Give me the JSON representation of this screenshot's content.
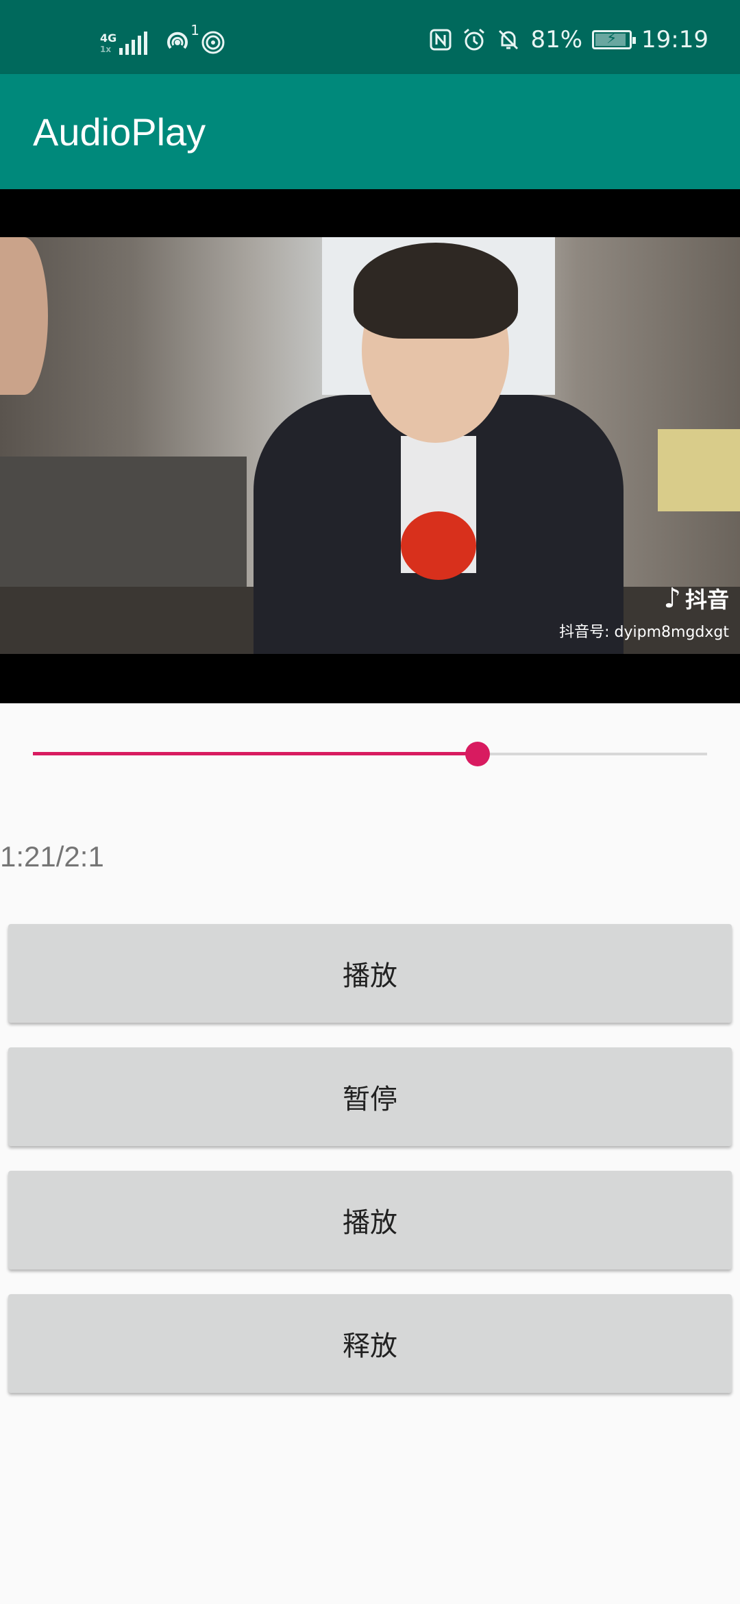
{
  "status_bar": {
    "network_type": "4G",
    "network_sub": "1x",
    "hotspot_superscript": "1",
    "battery": "81%",
    "battery_level": 0.81,
    "time": "19:19",
    "icons": [
      "signal-icon",
      "hotspot-icon",
      "wifi-icon",
      "nfc-icon",
      "alarm-icon",
      "mute-bell-icon",
      "battery-icon"
    ]
  },
  "app_bar": {
    "title": "AudioPlay"
  },
  "video": {
    "watermark_brand": "抖音",
    "watermark_id": "抖音号: dyipm8mgdxgt"
  },
  "player": {
    "progress": 0.66,
    "time_text": "1:21/2:1"
  },
  "buttons": {
    "play": "播放",
    "pause": "暂停",
    "replay": "播放",
    "release": "释放"
  },
  "colors": {
    "status_bar": "#00695c",
    "app_bar": "#00897b",
    "accent": "#d81b60",
    "button_bg": "#d6d7d7"
  }
}
